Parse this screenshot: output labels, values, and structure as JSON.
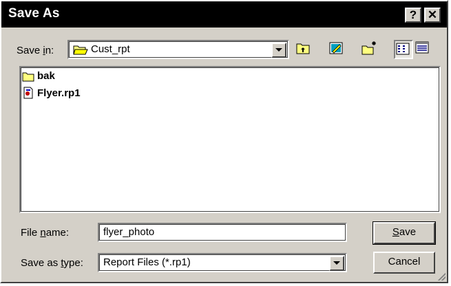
{
  "window": {
    "title": "Save As",
    "help_label": "?",
    "close_label": "✕"
  },
  "toolbar": {
    "save_in_label_pre": "Save ",
    "save_in_label_u": "i",
    "save_in_label_post": "n:",
    "current_folder": "Cust_rpt"
  },
  "files": [
    {
      "name": "bak",
      "icon": "folder-icon"
    },
    {
      "name": "Flyer.rp1",
      "icon": "report-file-icon"
    }
  ],
  "form": {
    "file_name_label_pre": "File ",
    "file_name_label_u": "n",
    "file_name_label_post": "ame:",
    "file_name_value": "flyer_photo",
    "type_label_pre": "Save as ",
    "type_label_u": "t",
    "type_label_post": "ype:",
    "type_value": "Report Files (*.rp1)"
  },
  "buttons": {
    "save_u": "S",
    "save_rest": "ave",
    "cancel": "Cancel"
  }
}
